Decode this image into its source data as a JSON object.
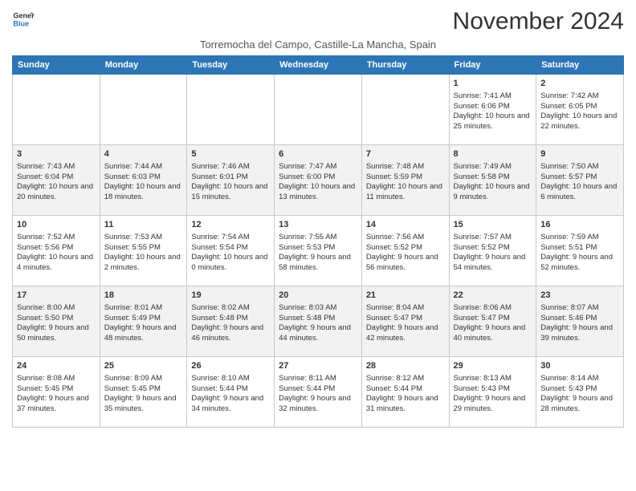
{
  "header": {
    "logo_line1": "General",
    "logo_line2": "Blue",
    "month": "November 2024",
    "location": "Torremocha del Campo, Castille-La Mancha, Spain"
  },
  "weekdays": [
    "Sunday",
    "Monday",
    "Tuesday",
    "Wednesday",
    "Thursday",
    "Friday",
    "Saturday"
  ],
  "weeks": [
    [
      {
        "day": "",
        "info": ""
      },
      {
        "day": "",
        "info": ""
      },
      {
        "day": "",
        "info": ""
      },
      {
        "day": "",
        "info": ""
      },
      {
        "day": "",
        "info": ""
      },
      {
        "day": "1",
        "info": "Sunrise: 7:41 AM\nSunset: 6:06 PM\nDaylight: 10 hours and 25 minutes."
      },
      {
        "day": "2",
        "info": "Sunrise: 7:42 AM\nSunset: 6:05 PM\nDaylight: 10 hours and 22 minutes."
      }
    ],
    [
      {
        "day": "3",
        "info": "Sunrise: 7:43 AM\nSunset: 6:04 PM\nDaylight: 10 hours and 20 minutes."
      },
      {
        "day": "4",
        "info": "Sunrise: 7:44 AM\nSunset: 6:03 PM\nDaylight: 10 hours and 18 minutes."
      },
      {
        "day": "5",
        "info": "Sunrise: 7:46 AM\nSunset: 6:01 PM\nDaylight: 10 hours and 15 minutes."
      },
      {
        "day": "6",
        "info": "Sunrise: 7:47 AM\nSunset: 6:00 PM\nDaylight: 10 hours and 13 minutes."
      },
      {
        "day": "7",
        "info": "Sunrise: 7:48 AM\nSunset: 5:59 PM\nDaylight: 10 hours and 11 minutes."
      },
      {
        "day": "8",
        "info": "Sunrise: 7:49 AM\nSunset: 5:58 PM\nDaylight: 10 hours and 9 minutes."
      },
      {
        "day": "9",
        "info": "Sunrise: 7:50 AM\nSunset: 5:57 PM\nDaylight: 10 hours and 6 minutes."
      }
    ],
    [
      {
        "day": "10",
        "info": "Sunrise: 7:52 AM\nSunset: 5:56 PM\nDaylight: 10 hours and 4 minutes."
      },
      {
        "day": "11",
        "info": "Sunrise: 7:53 AM\nSunset: 5:55 PM\nDaylight: 10 hours and 2 minutes."
      },
      {
        "day": "12",
        "info": "Sunrise: 7:54 AM\nSunset: 5:54 PM\nDaylight: 10 hours and 0 minutes."
      },
      {
        "day": "13",
        "info": "Sunrise: 7:55 AM\nSunset: 5:53 PM\nDaylight: 9 hours and 58 minutes."
      },
      {
        "day": "14",
        "info": "Sunrise: 7:56 AM\nSunset: 5:52 PM\nDaylight: 9 hours and 56 minutes."
      },
      {
        "day": "15",
        "info": "Sunrise: 7:57 AM\nSunset: 5:52 PM\nDaylight: 9 hours and 54 minutes."
      },
      {
        "day": "16",
        "info": "Sunrise: 7:59 AM\nSunset: 5:51 PM\nDaylight: 9 hours and 52 minutes."
      }
    ],
    [
      {
        "day": "17",
        "info": "Sunrise: 8:00 AM\nSunset: 5:50 PM\nDaylight: 9 hours and 50 minutes."
      },
      {
        "day": "18",
        "info": "Sunrise: 8:01 AM\nSunset: 5:49 PM\nDaylight: 9 hours and 48 minutes."
      },
      {
        "day": "19",
        "info": "Sunrise: 8:02 AM\nSunset: 5:48 PM\nDaylight: 9 hours and 46 minutes."
      },
      {
        "day": "20",
        "info": "Sunrise: 8:03 AM\nSunset: 5:48 PM\nDaylight: 9 hours and 44 minutes."
      },
      {
        "day": "21",
        "info": "Sunrise: 8:04 AM\nSunset: 5:47 PM\nDaylight: 9 hours and 42 minutes."
      },
      {
        "day": "22",
        "info": "Sunrise: 8:06 AM\nSunset: 5:47 PM\nDaylight: 9 hours and 40 minutes."
      },
      {
        "day": "23",
        "info": "Sunrise: 8:07 AM\nSunset: 5:46 PM\nDaylight: 9 hours and 39 minutes."
      }
    ],
    [
      {
        "day": "24",
        "info": "Sunrise: 8:08 AM\nSunset: 5:45 PM\nDaylight: 9 hours and 37 minutes."
      },
      {
        "day": "25",
        "info": "Sunrise: 8:09 AM\nSunset: 5:45 PM\nDaylight: 9 hours and 35 minutes."
      },
      {
        "day": "26",
        "info": "Sunrise: 8:10 AM\nSunset: 5:44 PM\nDaylight: 9 hours and 34 minutes."
      },
      {
        "day": "27",
        "info": "Sunrise: 8:11 AM\nSunset: 5:44 PM\nDaylight: 9 hours and 32 minutes."
      },
      {
        "day": "28",
        "info": "Sunrise: 8:12 AM\nSunset: 5:44 PM\nDaylight: 9 hours and 31 minutes."
      },
      {
        "day": "29",
        "info": "Sunrise: 8:13 AM\nSunset: 5:43 PM\nDaylight: 9 hours and 29 minutes."
      },
      {
        "day": "30",
        "info": "Sunrise: 8:14 AM\nSunset: 5:43 PM\nDaylight: 9 hours and 28 minutes."
      }
    ]
  ]
}
